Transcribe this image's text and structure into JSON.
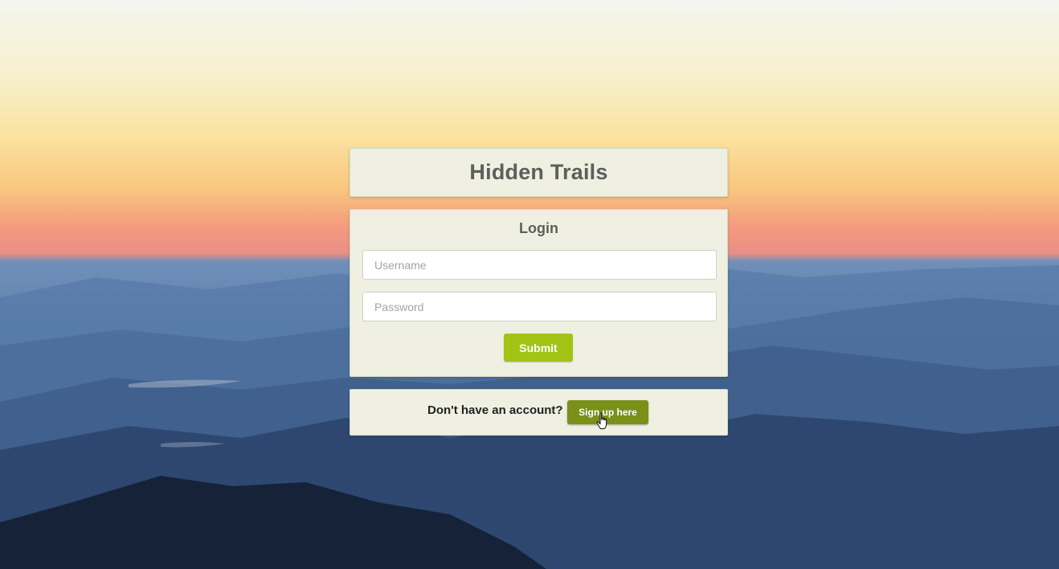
{
  "app": {
    "title": "Hidden Trails"
  },
  "login": {
    "heading": "Login",
    "username_placeholder": "Username",
    "username_value": "",
    "password_placeholder": "Password",
    "password_value": "",
    "submit_label": "Submit"
  },
  "signup": {
    "prompt": "Don't have an account?",
    "button_label": "Sign up here"
  },
  "background": {
    "icon": "mountain-sunset-background"
  },
  "cursor": {
    "icon": "hand-pointer-icon"
  },
  "colors": {
    "card_bg": "#eff0e1",
    "submit_bg": "#a3c315",
    "signup_bg": "#7a9018",
    "title_text": "#5d5f5a"
  }
}
